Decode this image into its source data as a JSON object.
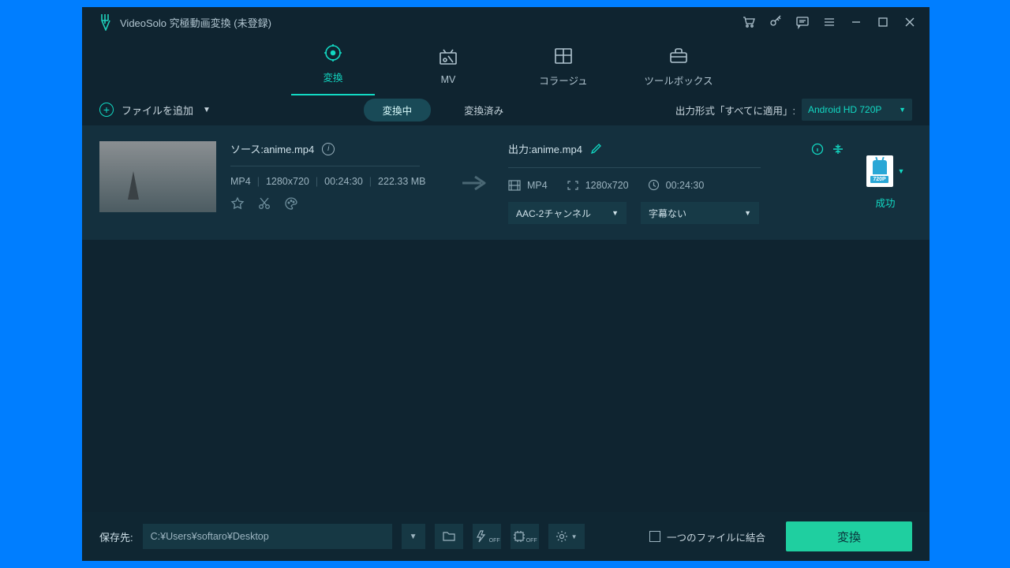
{
  "title": "VideoSolo 究極動画変換 (未登録)",
  "mainTabs": {
    "convert": "変換",
    "mv": "MV",
    "collage": "コラージュ",
    "toolbox": "ツールボックス"
  },
  "subbar": {
    "addFile": "ファイルを追加",
    "converting": "変換中",
    "converted": "変換済み",
    "outputApplyAll": "出力形式「すべてに適用」:",
    "formatPreset": "Android HD 720P"
  },
  "item": {
    "sourceLabel": "ソース:anime.mp4",
    "srcMeta": {
      "container": "MP4",
      "res": "1280x720",
      "dur": "00:24:30",
      "size": "222.33 MB"
    },
    "outputLabel": "出力:anime.mp4",
    "outMeta": {
      "container": "MP4",
      "res": "1280x720",
      "dur": "00:24:30"
    },
    "audioSel": "AAC-2チャンネル",
    "subSel": "字幕ない",
    "badge720": "720P",
    "status": "成功"
  },
  "bottom": {
    "saveLabel": "保存先:",
    "path": "C:¥Users¥softaro¥Desktop",
    "mergeLabel": "一つのファイルに結合",
    "convert": "変換"
  }
}
